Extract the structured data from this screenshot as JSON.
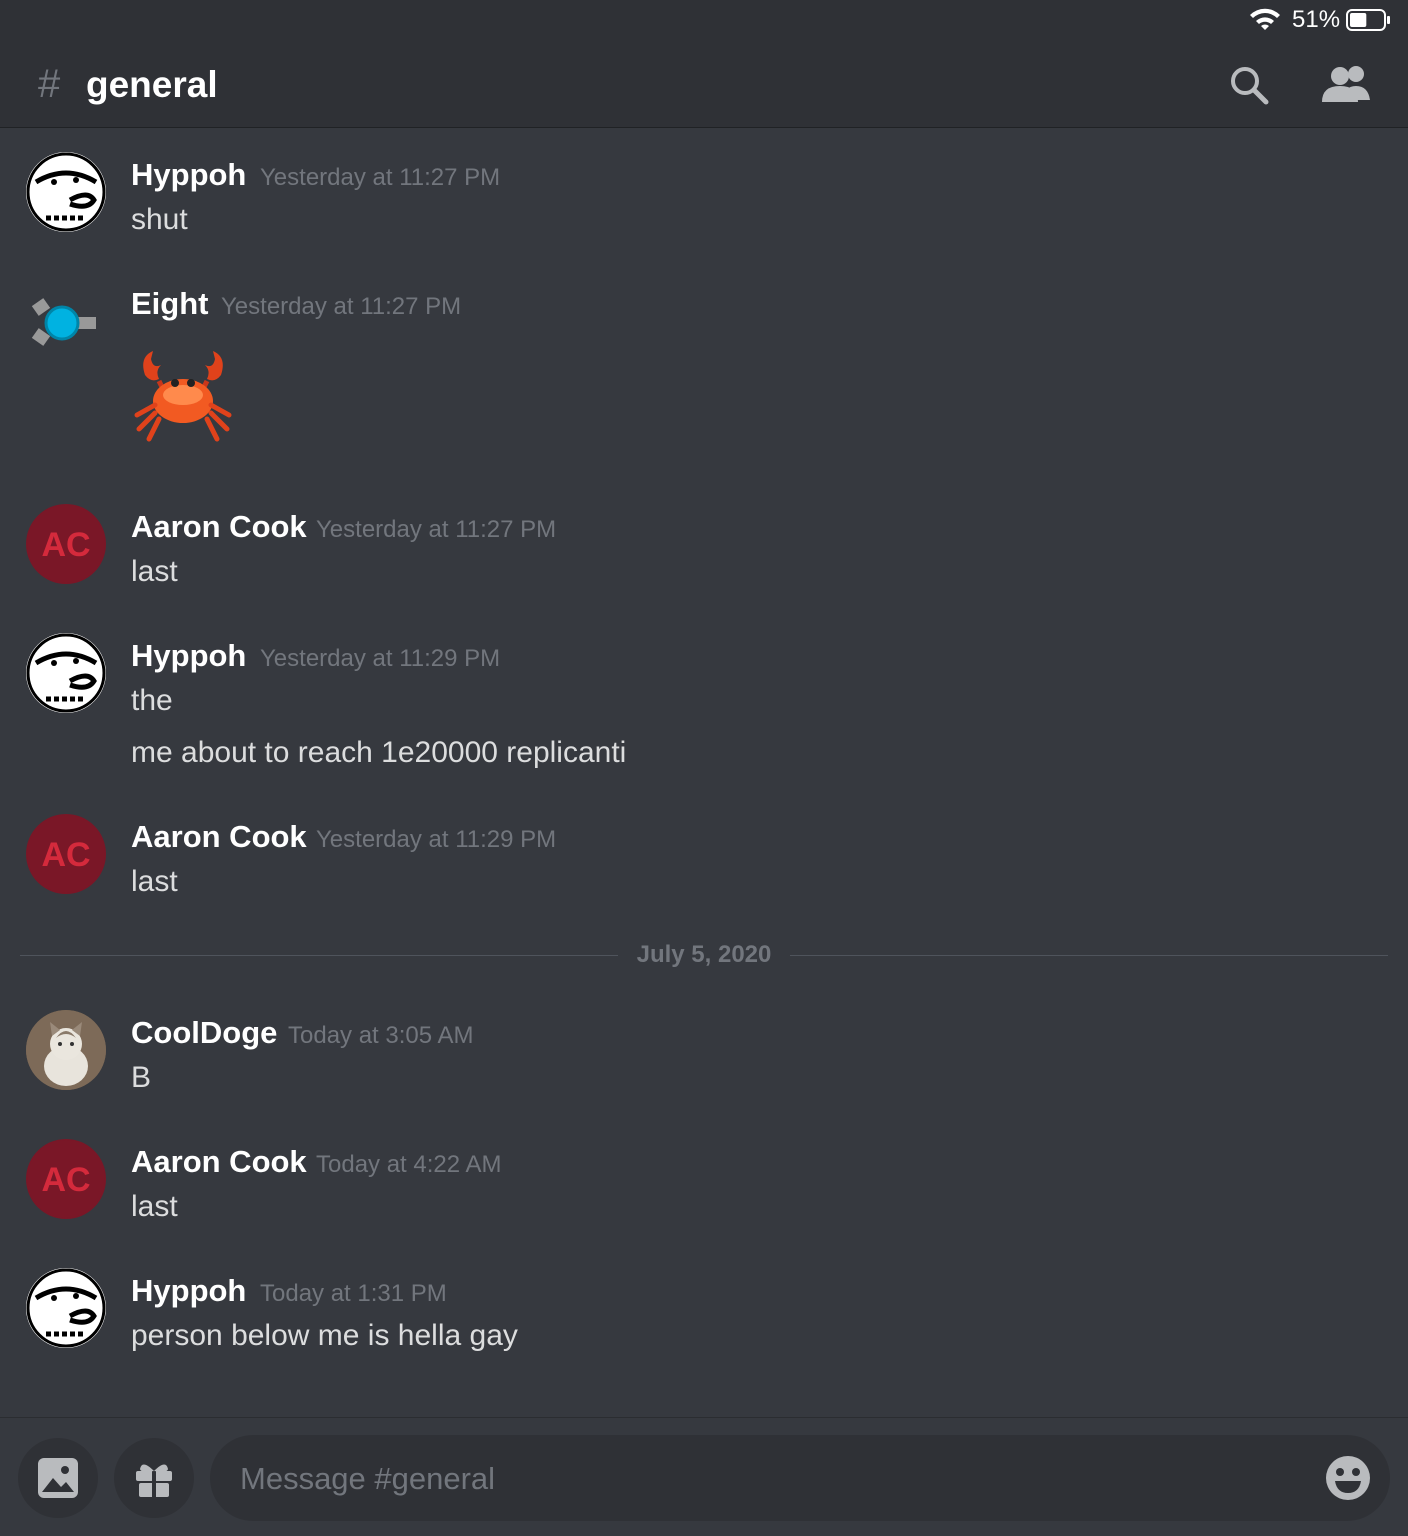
{
  "status_bar": {
    "battery_percent": "51%",
    "battery_level": 0.51
  },
  "header": {
    "hash_symbol": "#",
    "channel_name": "general"
  },
  "messages": [
    {
      "author": "Hyppoh",
      "timestamp": "Yesterday at 11:27 PM",
      "lines": [
        "shut"
      ],
      "avatar": "hyppoh-avatar"
    },
    {
      "author": "Eight",
      "timestamp": "Yesterday at 11:27 PM",
      "lines": [],
      "emoji": "🦀",
      "avatar": "eight-avatar"
    },
    {
      "author": "Aaron Cook",
      "timestamp": "Yesterday at 11:27 PM",
      "lines": [
        "last"
      ],
      "avatar": "ac-avatar",
      "avatar_text": "AC"
    },
    {
      "author": "Hyppoh",
      "timestamp": "Yesterday at 11:29 PM",
      "lines": [
        "the",
        "me about to reach 1e20000 replicanti"
      ],
      "avatar": "hyppoh-avatar"
    },
    {
      "author": "Aaron Cook",
      "timestamp": "Yesterday at 11:29 PM",
      "lines": [
        "last"
      ],
      "avatar": "ac-avatar",
      "avatar_text": "AC"
    },
    {
      "author": "CoolDoge",
      "timestamp": "Today at 3:05 AM",
      "lines": [
        "B"
      ],
      "avatar": "cat-avatar"
    },
    {
      "author": "Aaron Cook",
      "timestamp": "Today at 4:22 AM",
      "lines": [
        "last"
      ],
      "avatar": "ac-avatar",
      "avatar_text": "AC"
    },
    {
      "author": "Hyppoh",
      "timestamp": "Today at 1:31 PM",
      "lines": [
        "person below me is hella gay"
      ],
      "avatar": "hyppoh-avatar"
    }
  ],
  "date_divider": "July 5, 2020",
  "composer": {
    "placeholder": "Message #general"
  },
  "colors": {
    "background": "#36393f",
    "header": "#2f3136",
    "muted": "#72767d",
    "avatar_red": "#7a1727"
  }
}
